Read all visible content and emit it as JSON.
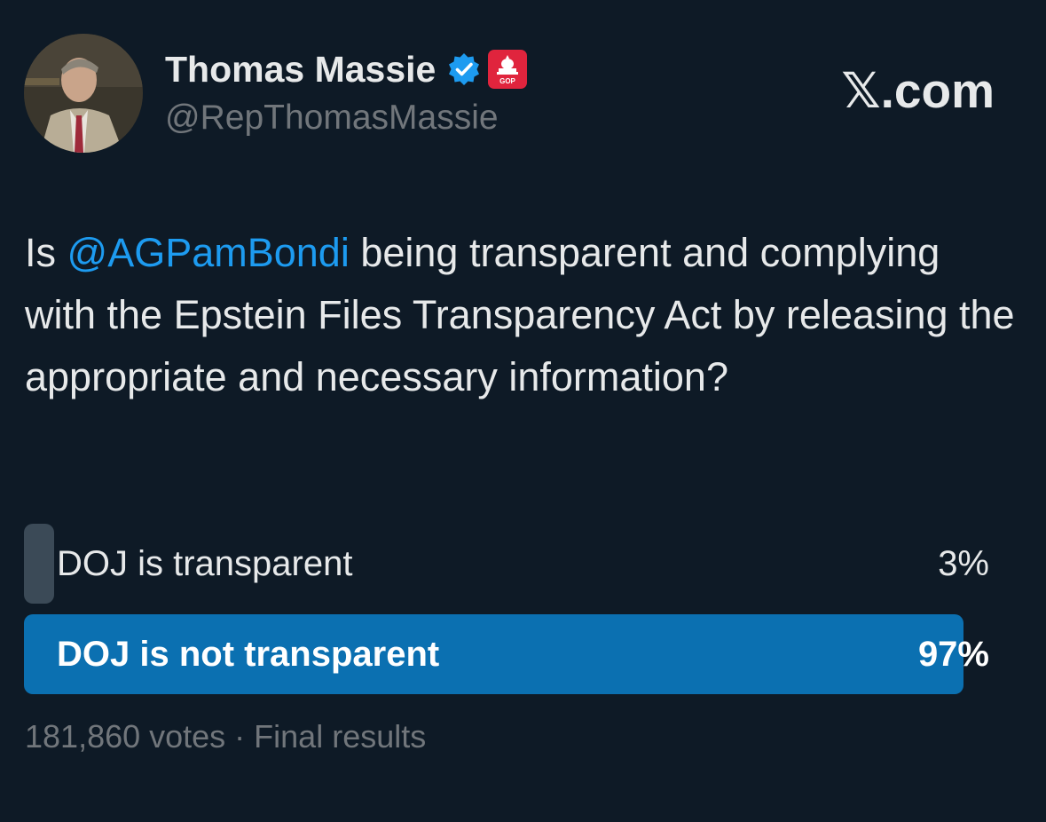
{
  "author": {
    "display_name": "Thomas Massie",
    "handle": "@RepThomasMassie",
    "verified": true,
    "verified_badge_color": "#1d9bf0",
    "affiliation_badge_color": "#e0243d",
    "affiliation_badge_text": "GOP"
  },
  "brand": {
    "label": "𝕏.com"
  },
  "tweet": {
    "text_before": "Is ",
    "mention": "@AGPamBondi",
    "text_after": " being transparent and complying with the Epstein Files Transparency Act by releasing the appropriate and necessary information?"
  },
  "poll": {
    "options": [
      {
        "label": "DOJ is transparent",
        "percent_label": "3%",
        "percent": 3,
        "winner": false
      },
      {
        "label": "DOJ is not transparent",
        "percent_label": "97%",
        "percent": 97,
        "winner": true
      }
    ],
    "footer": "181,860 votes · Final results"
  },
  "colors": {
    "background": "#0e1a26",
    "text": "#e7e9ea",
    "muted": "#71767b",
    "mention": "#1d9bf0",
    "winner_bar": "#0b70b1",
    "loser_bar": "#3b4a57"
  }
}
